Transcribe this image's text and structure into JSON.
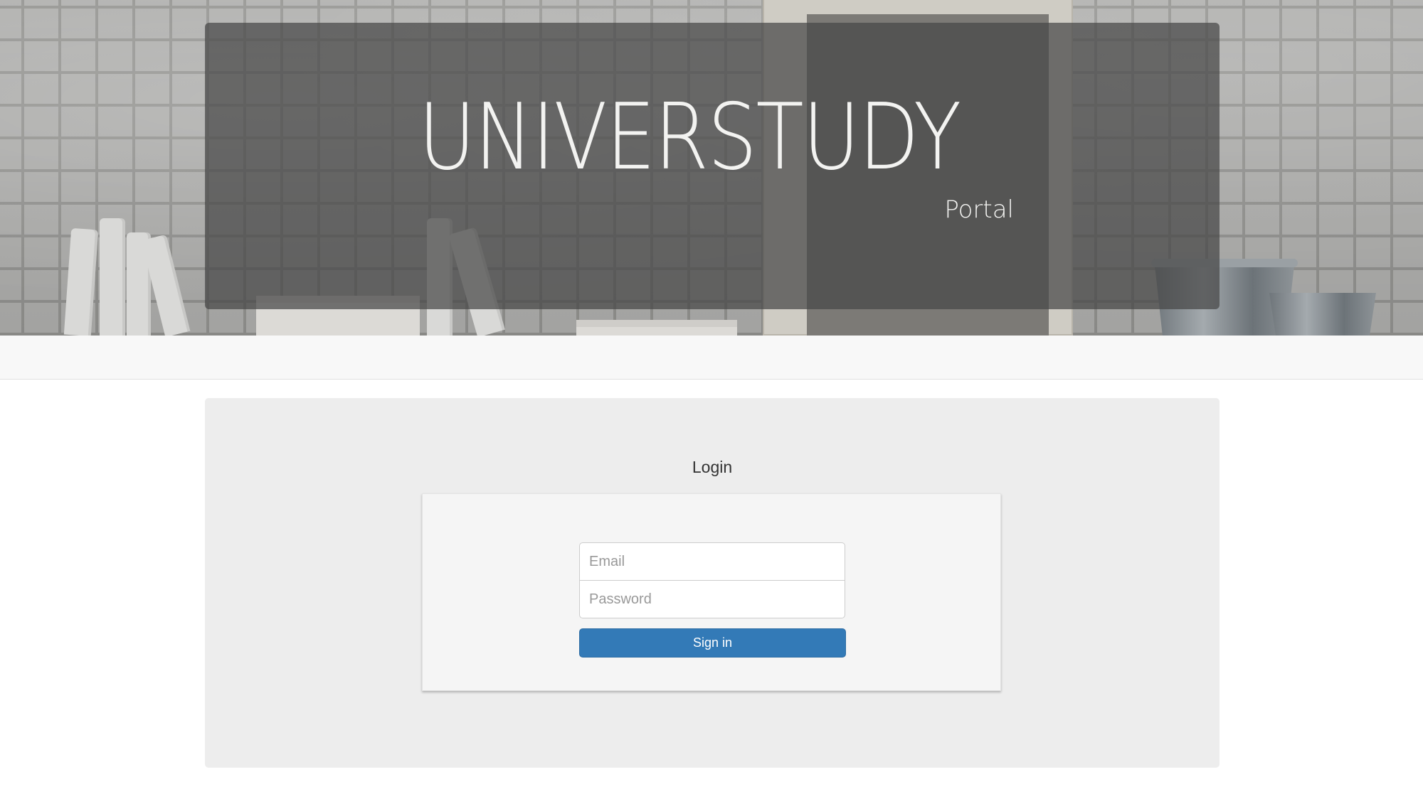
{
  "header": {
    "brand": "UNIVERSTUDY",
    "subtitle": "Portal"
  },
  "login": {
    "title": "Login",
    "email_placeholder": "Email",
    "password_placeholder": "Password",
    "signin_label": "Sign in"
  },
  "colors": {
    "primary_button": "#337ab7",
    "panel_background": "#ededed",
    "navbar_background": "#f8f8f8"
  }
}
